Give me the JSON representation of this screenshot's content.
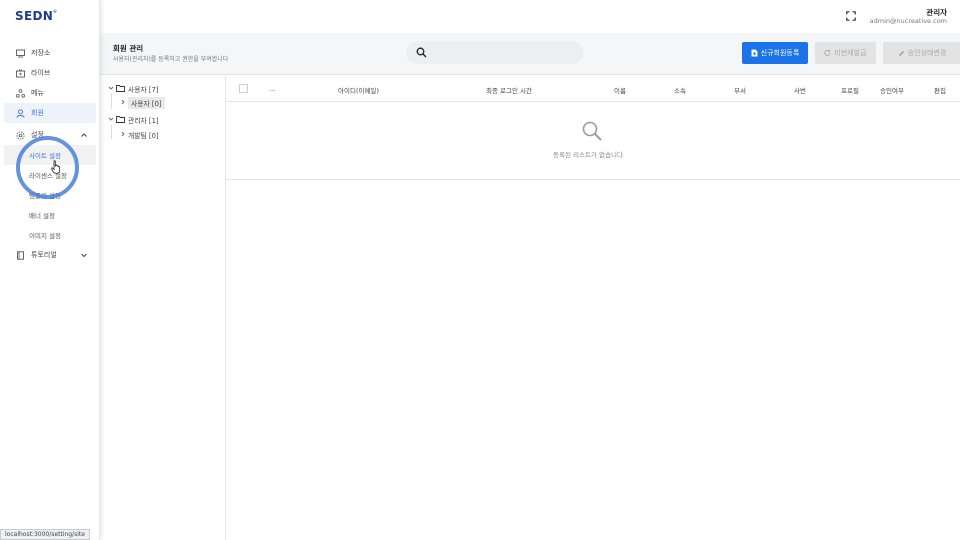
{
  "brand": {
    "logo": "SEDN",
    "mark": "®"
  },
  "sidebar": {
    "items": [
      {
        "label": "저장소",
        "icon": "storage-icon"
      },
      {
        "label": "라이브",
        "icon": "live-icon"
      },
      {
        "label": "메뉴",
        "icon": "menu-icon"
      },
      {
        "label": "회원",
        "icon": "member-icon"
      },
      {
        "label": "설정",
        "icon": "gear-icon"
      }
    ],
    "settings_sub": [
      {
        "label": "사이트 설정"
      },
      {
        "label": "라이센스 설정"
      },
      {
        "label": "템플릿 설정"
      },
      {
        "label": "배너 설정"
      },
      {
        "label": "이미지 설정"
      }
    ],
    "tutorial": {
      "label": "튜토리얼",
      "icon": "book-icon"
    }
  },
  "header": {
    "user_name": "관리자",
    "user_email": "admin@nucreative.com"
  },
  "page": {
    "title": "회원 관리",
    "subtitle": "사용자(관리자)를 등록하고 권한을 부여합니다",
    "search_placeholder": "",
    "buttons": {
      "register": "신규회원등록",
      "reset": "비번재발급",
      "approve": "승인상태변경"
    }
  },
  "tree": {
    "groups": [
      {
        "label": "사용자 [7]",
        "children": [
          {
            "label": "사용자 [0]"
          }
        ]
      },
      {
        "label": "관리자 [1]",
        "children": [
          {
            "label": "개발팀 [0]"
          }
        ]
      }
    ]
  },
  "table": {
    "columns": [
      "...",
      "아이디(이메일)",
      "최종 로그인 시간",
      "이름",
      "소속",
      "부서",
      "사번",
      "프로필",
      "승인여부",
      "편집"
    ],
    "empty_message": "등록된 리스트가 없습니다."
  },
  "status_url": "localhost:3000/setting/site",
  "colors": {
    "primary": "#1a73e8",
    "active_nav": "#3a6fd6",
    "brand": "#1f3b8f"
  }
}
